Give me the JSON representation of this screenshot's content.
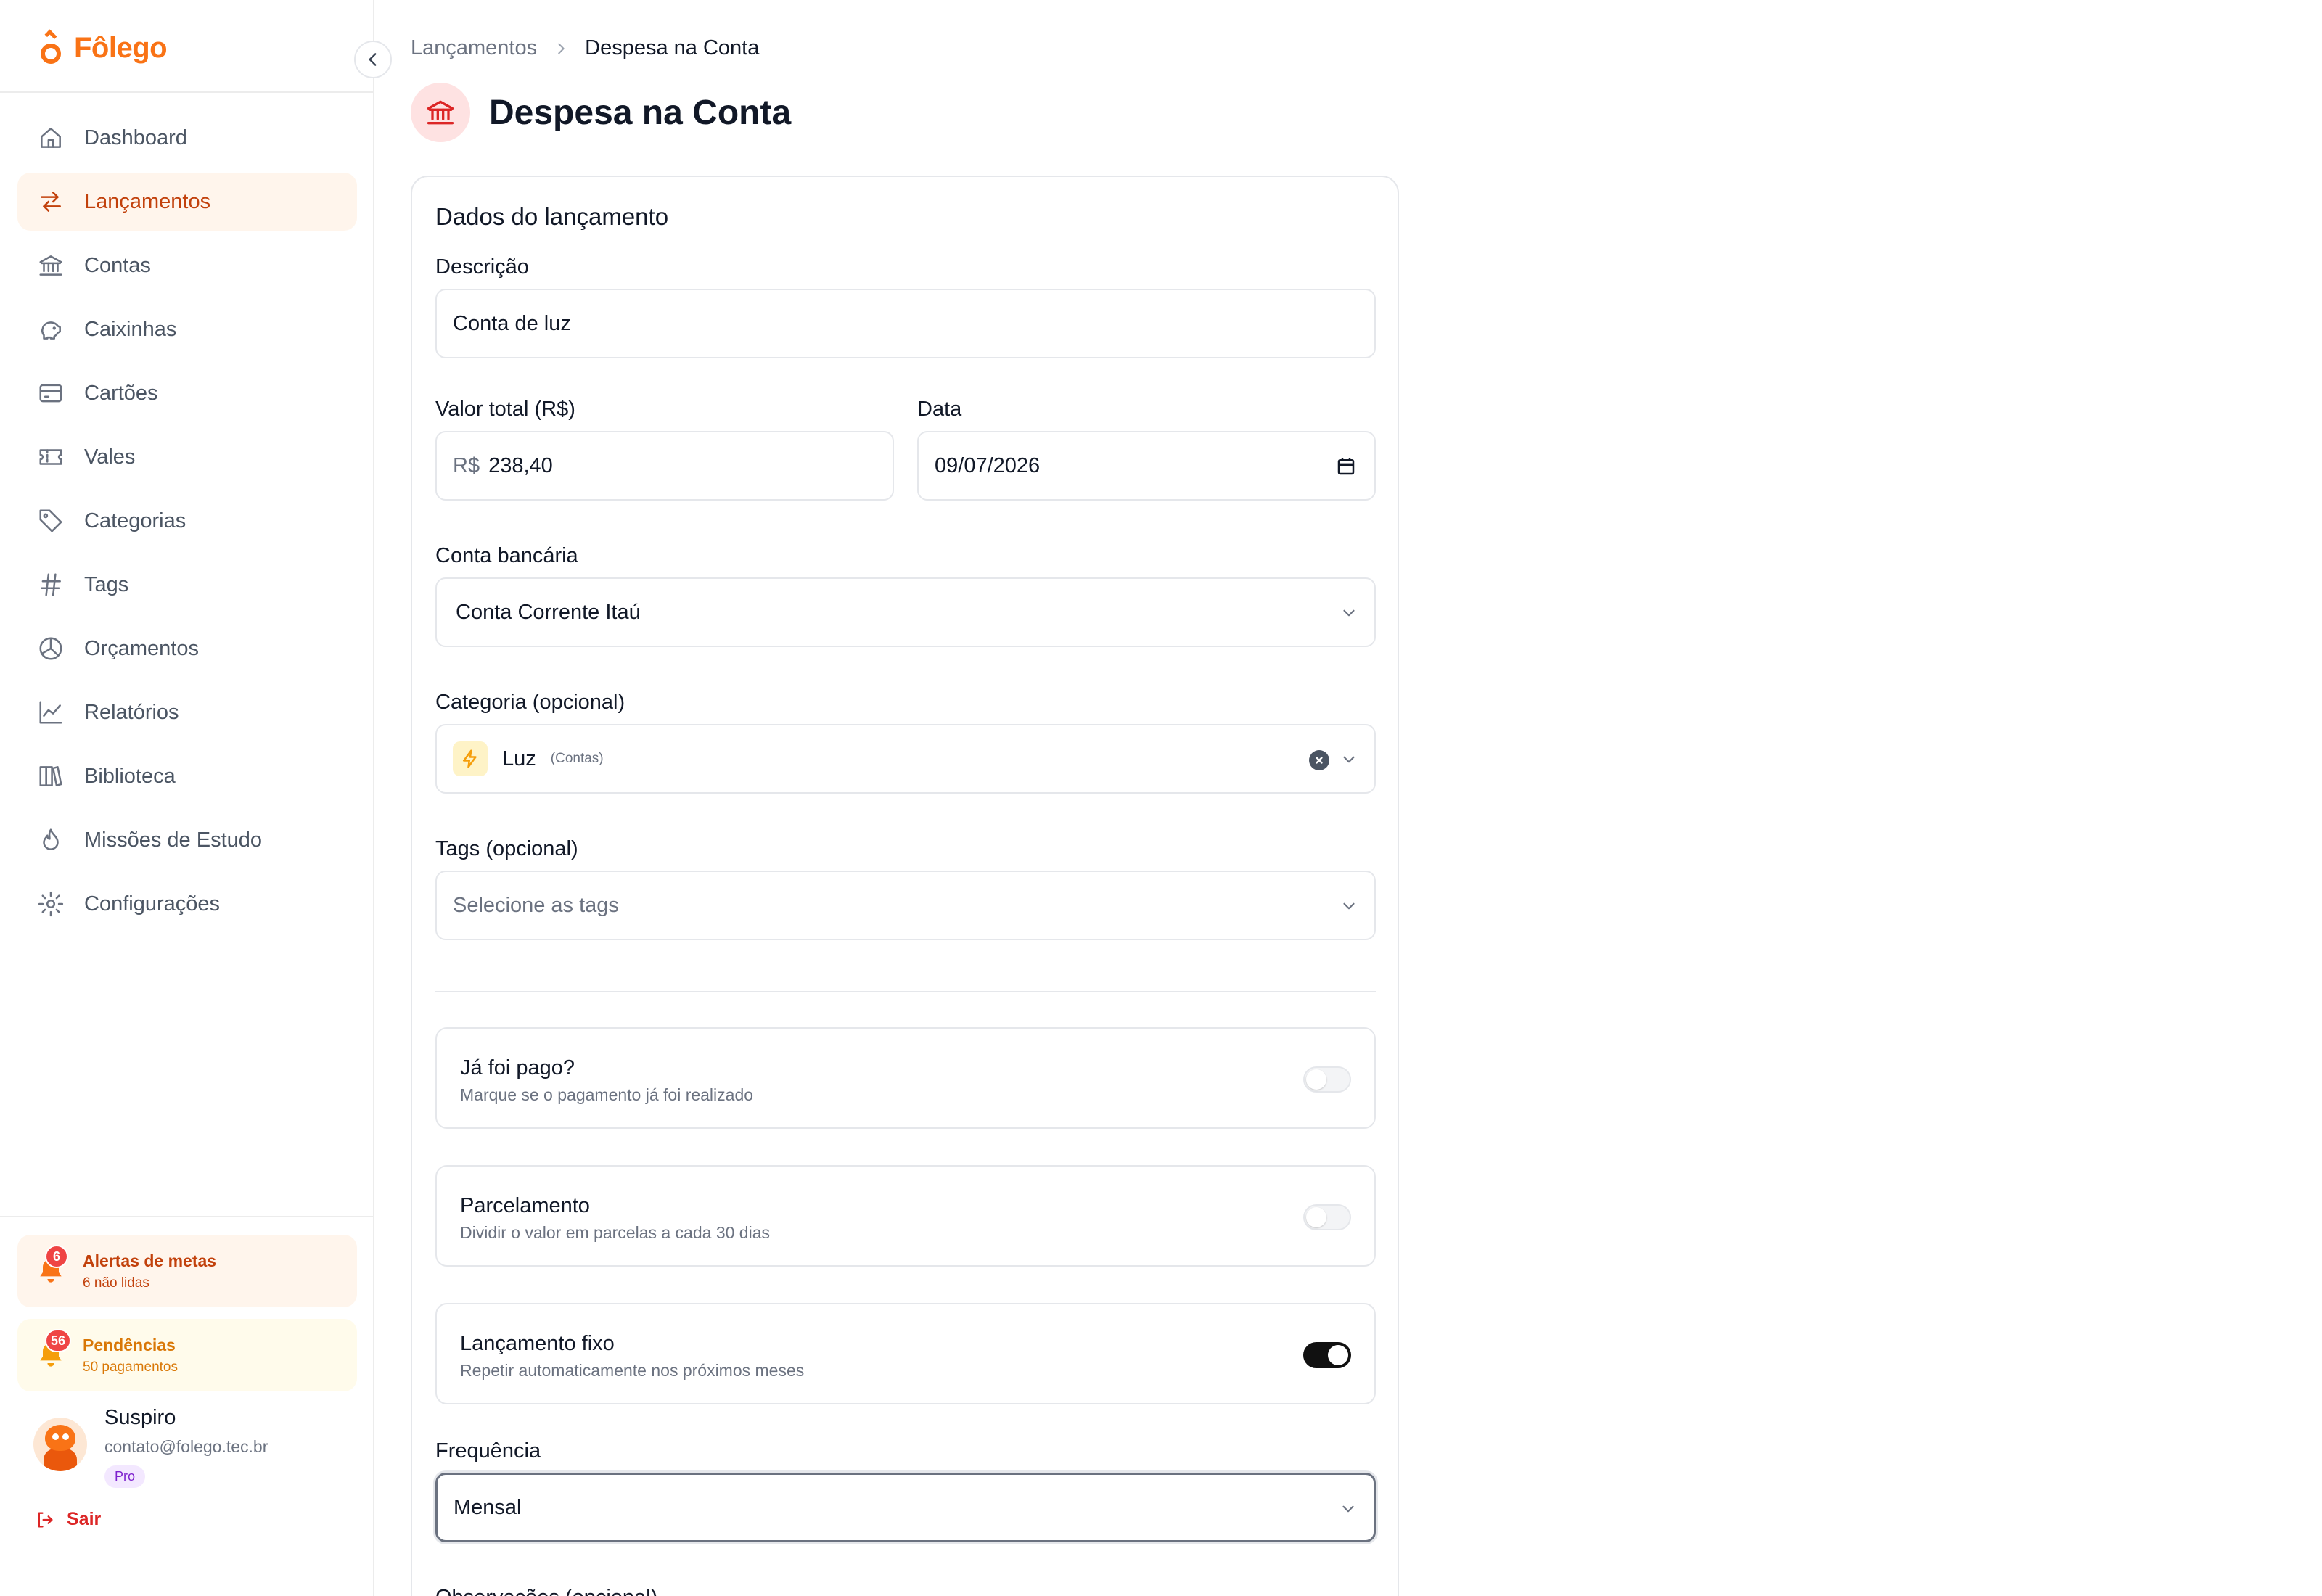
{
  "app": {
    "name": "Fôlego",
    "accent": "#f97316"
  },
  "sidebar": {
    "items": [
      {
        "label": "Dashboard",
        "icon": "home-icon",
        "active": false
      },
      {
        "label": "Lançamentos",
        "icon": "arrows-swap-icon",
        "active": true
      },
      {
        "label": "Contas",
        "icon": "bank-icon",
        "active": false
      },
      {
        "label": "Caixinhas",
        "icon": "piggy-bank-icon",
        "active": false
      },
      {
        "label": "Cartões",
        "icon": "credit-card-icon",
        "active": false
      },
      {
        "label": "Vales",
        "icon": "ticket-icon",
        "active": false
      },
      {
        "label": "Categorias",
        "icon": "tag-icon",
        "active": false
      },
      {
        "label": "Tags",
        "icon": "hash-icon",
        "active": false
      },
      {
        "label": "Orçamentos",
        "icon": "pie-chart-icon",
        "active": false
      },
      {
        "label": "Relatórios",
        "icon": "line-chart-icon",
        "active": false
      },
      {
        "label": "Biblioteca",
        "icon": "books-icon",
        "active": false
      },
      {
        "label": "Missões de Estudo",
        "icon": "flame-icon",
        "active": false
      },
      {
        "label": "Configurações",
        "icon": "gear-icon",
        "active": false
      }
    ],
    "alerts": {
      "metas": {
        "title": "Alertas de metas",
        "subtitle": "6 não lidas",
        "count": "6"
      },
      "pendencias": {
        "title": "Pendências",
        "subtitle": "50 pagamentos",
        "count": "56"
      }
    },
    "user": {
      "name": "Suspiro",
      "email": "contato@folego.tec.br",
      "plan": "Pro"
    },
    "logout_label": "Sair"
  },
  "breadcrumb": {
    "parent": "Lançamentos",
    "current": "Despesa na Conta"
  },
  "page": {
    "title": "Despesa na Conta"
  },
  "form": {
    "section_title": "Dados do lançamento",
    "descricao": {
      "label": "Descrição",
      "value": "Conta de luz"
    },
    "valor": {
      "label": "Valor total (R$)",
      "prefix": "R$",
      "value": "238,40"
    },
    "data": {
      "label": "Data",
      "value": "09/07/2026"
    },
    "conta": {
      "label": "Conta bancária",
      "value": "Conta Corrente Itaú"
    },
    "categoria": {
      "label": "Categoria (opcional)",
      "value": "Luz",
      "group": "(Contas)"
    },
    "tags": {
      "label": "Tags (opcional)",
      "placeholder": "Selecione as tags"
    },
    "pago": {
      "title": "Já foi pago?",
      "subtitle": "Marque se o pagamento já foi realizado",
      "on": false
    },
    "parcelamento": {
      "title": "Parcelamento",
      "subtitle": "Dividir o valor em parcelas a cada 30 dias",
      "on": false
    },
    "fixo": {
      "title": "Lançamento fixo",
      "subtitle": "Repetir automaticamente nos próximos meses",
      "on": true
    },
    "frequencia": {
      "label": "Frequência",
      "value": "Mensal"
    },
    "observacoes": {
      "label": "Observações (opcional)"
    }
  }
}
